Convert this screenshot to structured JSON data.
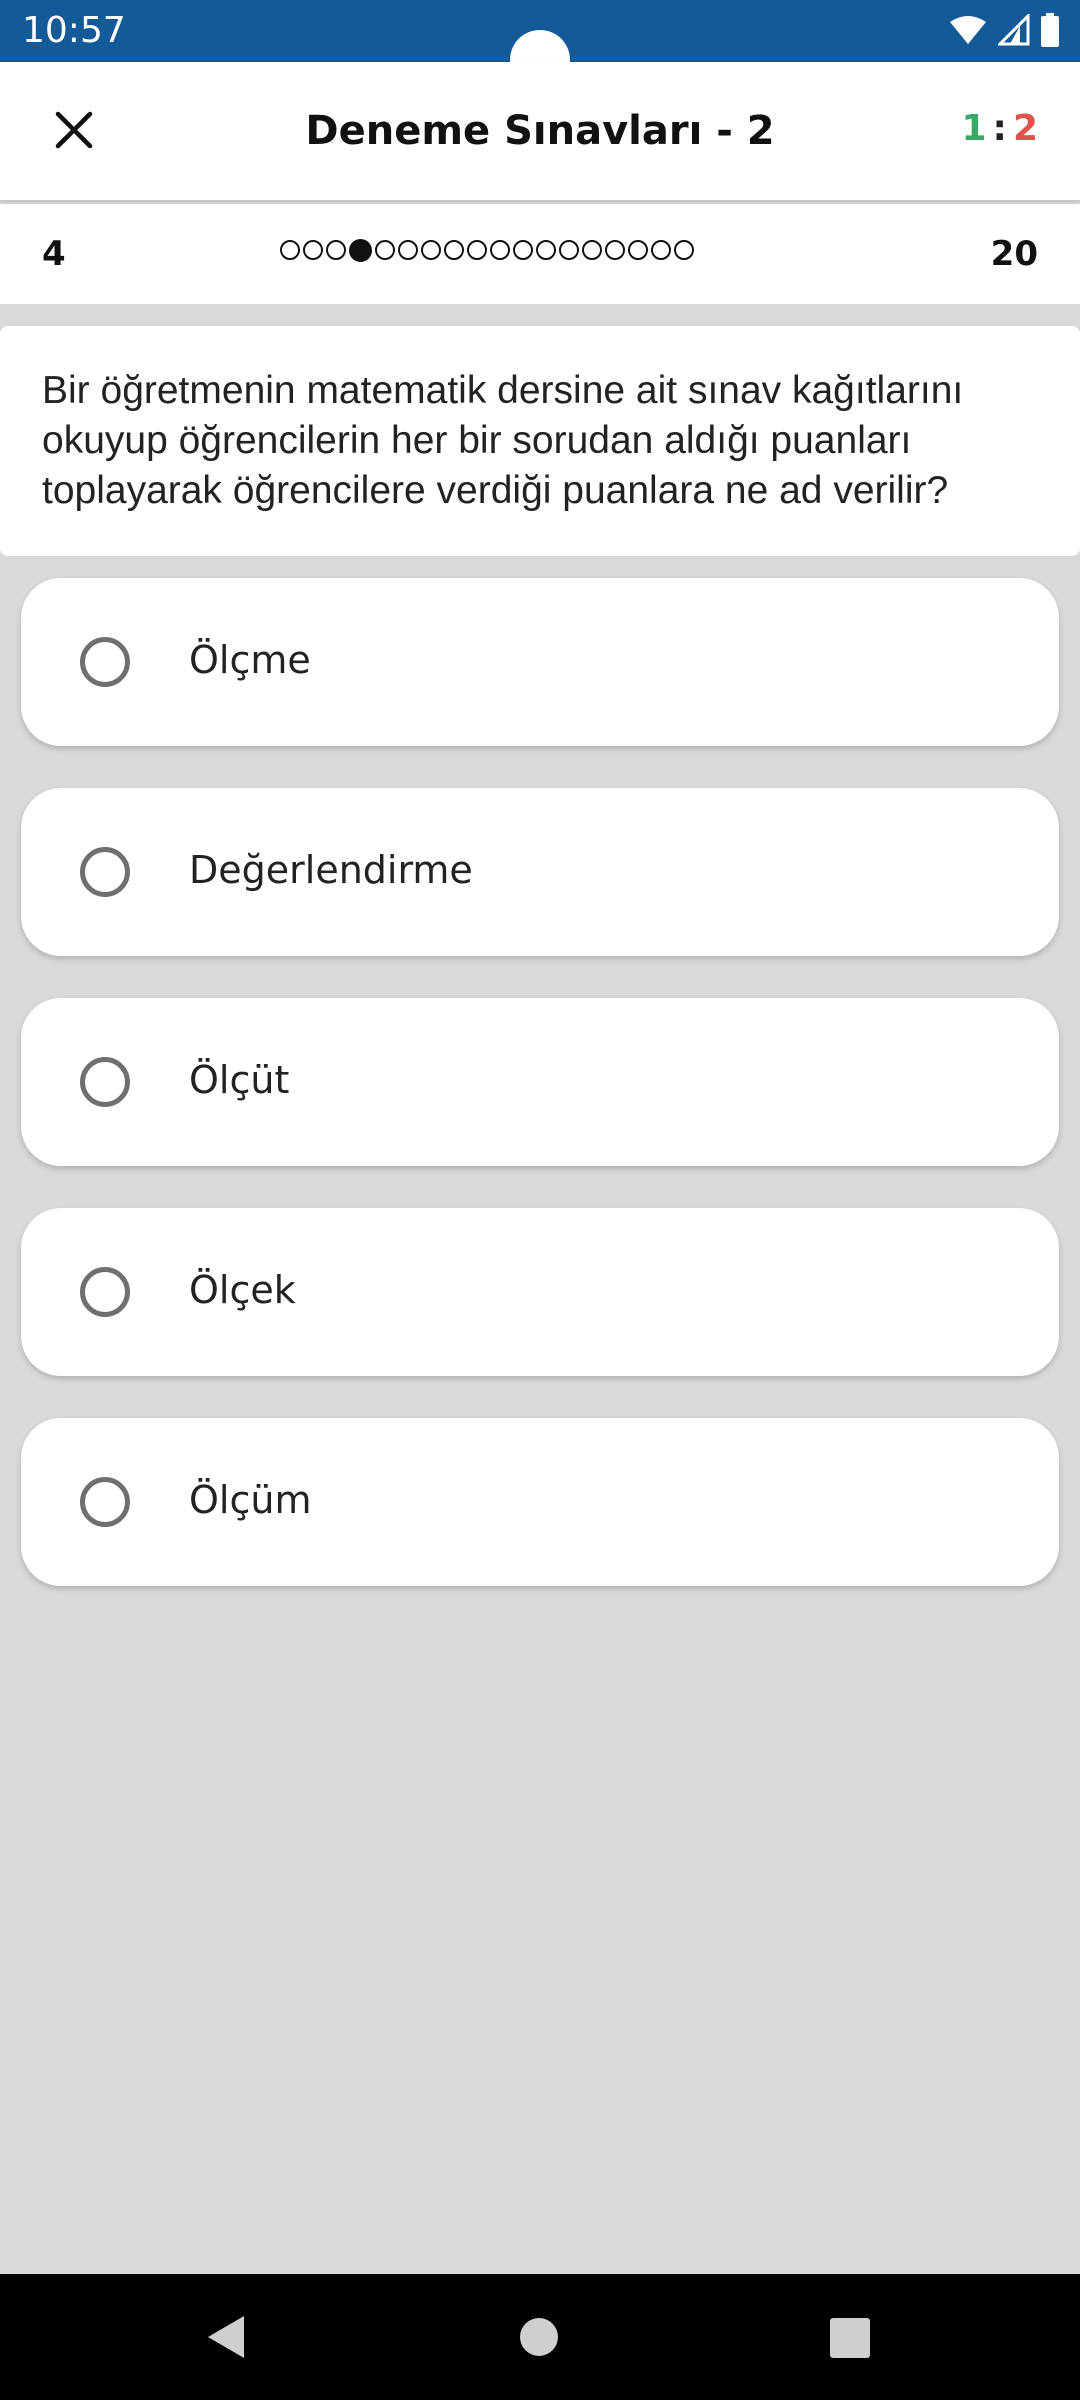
{
  "status_bar": {
    "time": "10:57",
    "icons": [
      "wifi-icon",
      "signal-icon",
      "battery-icon"
    ],
    "background": "#135a99"
  },
  "app_bar": {
    "title": "Deneme Sınavları - 2",
    "score": {
      "correct": "1",
      "separator": ":",
      "wrong": "2"
    },
    "close_icon": "close-icon"
  },
  "progress": {
    "current": "4",
    "total": "20",
    "dot_count": 18,
    "active_index": 3
  },
  "question": {
    "text": "Bir öğretmenin matematik dersine ait sınav kağıtlarını okuyup öğrencilerin her bir sorudan aldığı puanları toplayarak öğrencilere verdiği puanlara ne ad verilir?"
  },
  "options": [
    {
      "label": "Ölçme"
    },
    {
      "label": "Değerlendirme"
    },
    {
      "label": "Ölçüt"
    },
    {
      "label": "Ölçek"
    },
    {
      "label": "Ölçüm"
    }
  ],
  "colors": {
    "correct": "#3aa866",
    "wrong": "#e0524a",
    "background": "#d9d9d9"
  }
}
